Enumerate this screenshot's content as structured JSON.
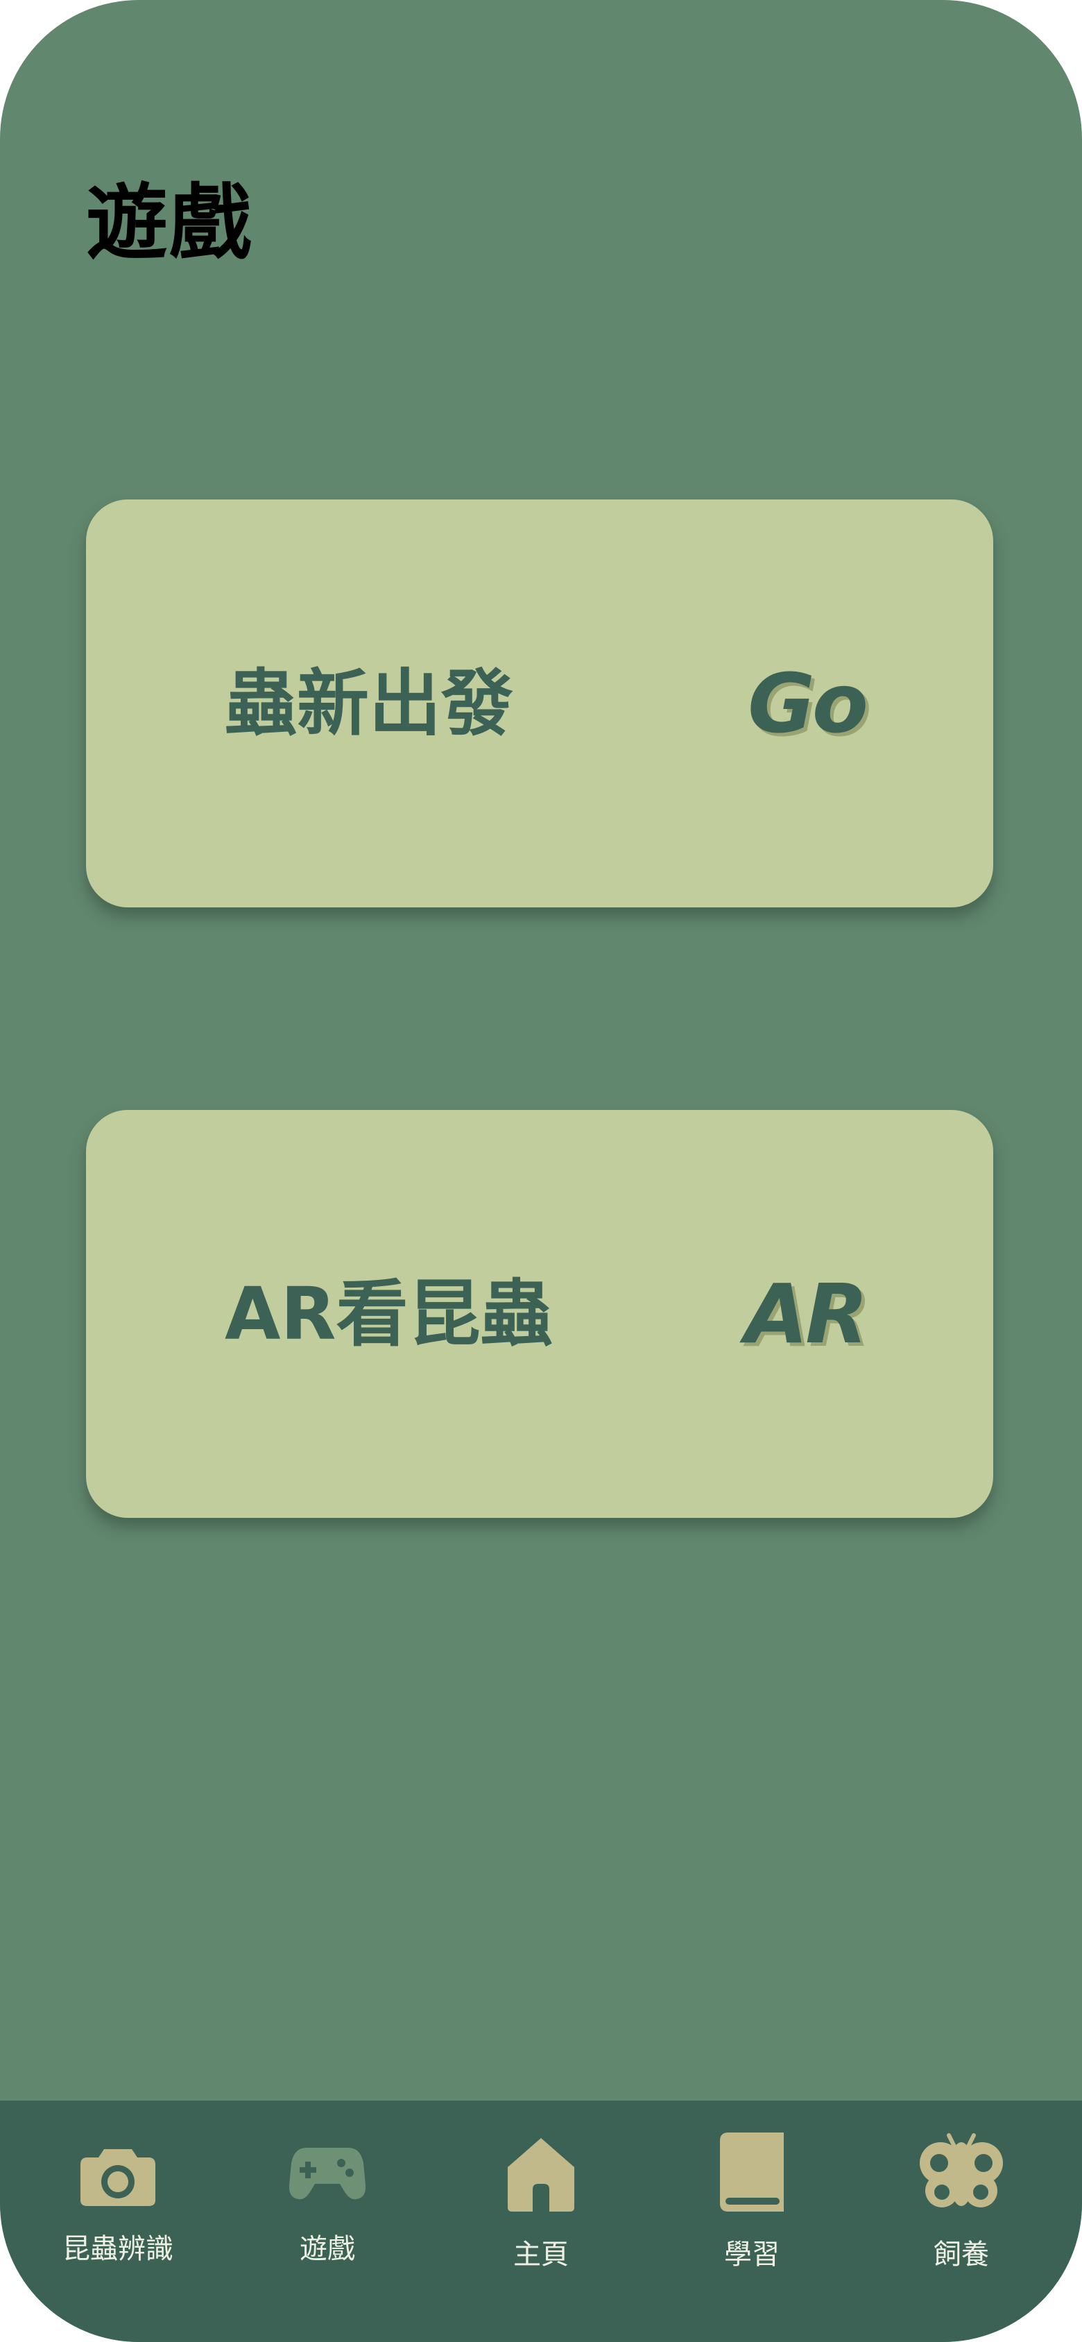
{
  "screen": {
    "title": "遊戲"
  },
  "cards": [
    {
      "label": "蟲新出發",
      "tag": "Go"
    },
    {
      "label": "AR看昆蟲",
      "tag": "AR"
    }
  ],
  "tabbar": {
    "active_index": 1,
    "items": [
      {
        "label": "昆蟲辨識",
        "icon": "camera-icon"
      },
      {
        "label": "遊戲",
        "icon": "gamepad-icon"
      },
      {
        "label": "主頁",
        "icon": "home-icon"
      },
      {
        "label": "學習",
        "icon": "book-icon"
      },
      {
        "label": "飼養",
        "icon": "butterfly-icon"
      }
    ]
  },
  "colors": {
    "background": "#61876e",
    "card": "#c1cd9d",
    "card_text": "#3c6255",
    "tabbar": "#3c6255",
    "tab_icon": "#c1b98a",
    "tab_icon_active": "#6e9175",
    "tab_label": "#eef0e4"
  }
}
